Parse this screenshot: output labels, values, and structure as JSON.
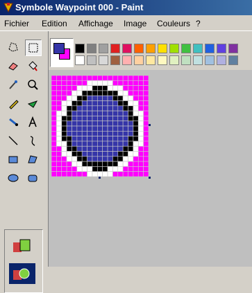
{
  "window": {
    "title": "Symbole Waypoint 000 - Paint"
  },
  "menu": [
    "Fichier",
    "Edition",
    "Affichage",
    "Image",
    "Couleurs",
    "?"
  ],
  "tools": [
    {
      "name": "free-select-tool",
      "icon": "free-select-icon"
    },
    {
      "name": "rect-select-tool",
      "icon": "rect-select-icon",
      "selected": true
    },
    {
      "name": "eraser-tool",
      "icon": "eraser-icon"
    },
    {
      "name": "fill-tool",
      "icon": "paint-bucket-icon"
    },
    {
      "name": "color-picker-tool",
      "icon": "eyedropper-icon"
    },
    {
      "name": "magnifier-tool",
      "icon": "magnifier-icon"
    },
    {
      "name": "pencil-tool",
      "icon": "pencil-icon"
    },
    {
      "name": "brush-tool",
      "icon": "brush-icon"
    },
    {
      "name": "airbrush-tool",
      "icon": "airbrush-icon"
    },
    {
      "name": "text-tool",
      "icon": "text-a-icon"
    },
    {
      "name": "line-tool",
      "icon": "line-icon"
    },
    {
      "name": "curve-tool",
      "icon": "curve-icon"
    },
    {
      "name": "rectangle-tool",
      "icon": "rectangle-icon"
    },
    {
      "name": "polygon-tool",
      "icon": "polygon-icon"
    },
    {
      "name": "ellipse-tool",
      "icon": "ellipse-icon"
    },
    {
      "name": "rounded-rect-tool",
      "icon": "rounded-rect-icon"
    }
  ],
  "options": [
    {
      "name": "opaque-selection-option",
      "selected": false
    },
    {
      "name": "transparent-selection-option",
      "selected": true
    }
  ],
  "palette": {
    "foreground": "#3535a8",
    "background": "#ff00ff",
    "top_row": [
      "#000000",
      "#808080",
      "#800000",
      "#808000",
      "#008000",
      "#008080",
      "#000080",
      "#800080",
      "#808040",
      "#004040",
      "#0080ff",
      "#004080",
      "#4000ff",
      "#804000"
    ],
    "top_row_visible": [
      "#000000",
      "#808080",
      "#a0a0a0",
      "#e02020",
      "#e01060",
      "#ff6000",
      "#ffa000",
      "#ffe000",
      "#a0e000",
      "#40c040",
      "#40c0c0",
      "#2060e0",
      "#6040e0",
      "#8030a0"
    ],
    "bottom_row_visible": [
      "#ffffff",
      "#c0c0c0",
      "#d8d8d8",
      "#a06040",
      "#ffb0b0",
      "#ffd0a0",
      "#ffe8a0",
      "#fff8c0",
      "#e0f0c0",
      "#c0e0c0",
      "#c0e0e0",
      "#a0c0e0",
      "#b0b0e0",
      "#6080a0"
    ]
  },
  "canvas": {
    "colors": {
      "M": "#ff00ff",
      "W": "#ffffff",
      "K": "#000000",
      "B": "#3535a8"
    },
    "pixels": [
      "MMMMMMMMMMMMMMMMMMM",
      "MMMMMMMWWWWWMMMMMMM",
      "MMMMMWWWKKKWWWMMMMM",
      "MMMMWWKKKKKKKWWMMMM",
      "MMMWWKKBBBBBKKWWMMM",
      "MMWWKKBBBBBBBKKWWMM",
      "MMWKKBBBBBBBBBKKWMM",
      "MWWKBBBBBBBBBBBKWWM",
      "MWKKBBBBBBBBBBBKKWM",
      "MWKBBBBBBBBBBBBBKWM",
      "MWKBBBBBBBBBBBBBKWM",
      "MWKBBBBBBBBBBBBBKWM",
      "MWKKBBBBBBBBBBBKKWM",
      "MWWKBBBBBBBBBBBKWWM",
      "MMWKKBBBBBBBBBKKWMM",
      "MMWWKKBBBBBBBKKWWMM",
      "MMMWWKKBBBBBKKWWMMM",
      "MMMMWWKKKKKKKWWMMMM",
      "MMMMMWWWKKKWWWMMMMM",
      "MMMMMMMWWWWWMMMMMMM"
    ]
  }
}
